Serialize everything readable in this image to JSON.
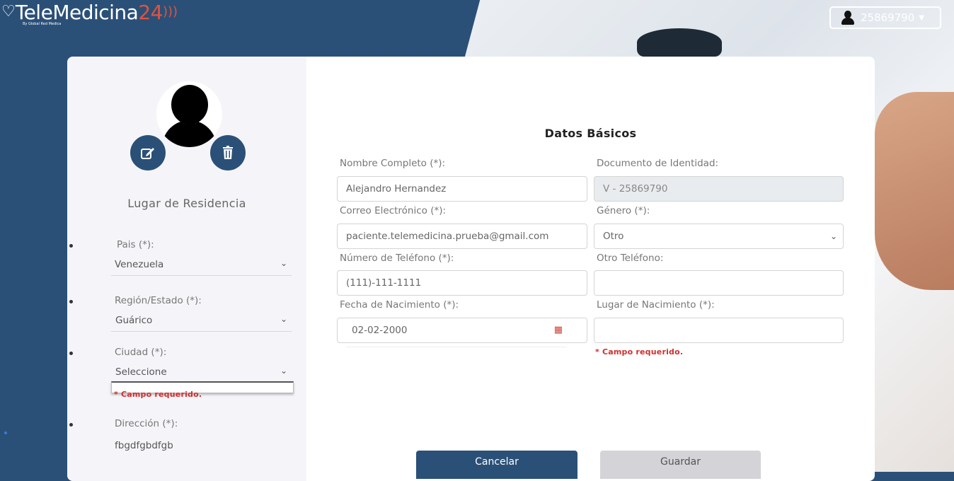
{
  "header": {
    "brand_main": "TeleMedicina",
    "brand_num": "24",
    "brand_sub": "By Global Red Medica",
    "user_id": "25869790"
  },
  "avatar": {
    "edit_label": "edit",
    "delete_label": "delete"
  },
  "residence": {
    "title": "Lugar de Residencia",
    "pais_label": "Pais (*):",
    "pais_value": "Venezuela",
    "region_label": "Región/Estado (*):",
    "region_value": "Guárico",
    "ciudad_label": "Ciudad (*):",
    "ciudad_value": "Seleccione",
    "ciudad_error": "* Campo requerido.",
    "direccion_label": "Dirección (*):",
    "direccion_value": "fbgdfgbdfgb"
  },
  "basic": {
    "title": "Datos Básicos",
    "nombre_label": "Nombre Completo (*):",
    "nombre_value": "Alejandro Hernandez",
    "documento_label": "Documento de Identidad:",
    "documento_value": "V - 25869790",
    "correo_label": "Correo Electrónico (*):",
    "correo_value": "paciente.telemedicina.prueba@gmail.com",
    "genero_label": "Género (*):",
    "genero_value": "Otro",
    "telefono_label": "Número de Teléfono (*):",
    "telefono_value": "(111)-111-1111",
    "otro_tel_label": "Otro Teléfono:",
    "otro_tel_value": "",
    "fecha_label": "Fecha de Nacimiento (*):",
    "fecha_value": "02-02-2000",
    "lugar_label": "Lugar de Nacimiento (*):",
    "lugar_value": "",
    "lugar_error": "* Campo requerido."
  },
  "actions": {
    "cancel": "Cancelar",
    "save": "Guardar"
  }
}
